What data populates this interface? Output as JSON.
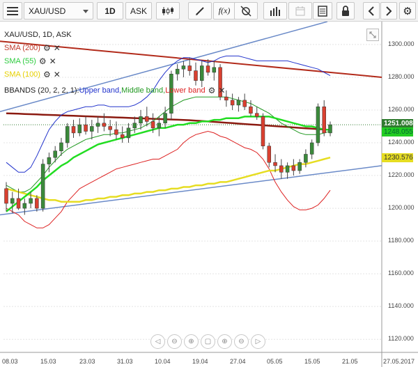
{
  "toolbar": {
    "symbol": "XAU/USD",
    "timeframe": "1D",
    "price_type": "ASK",
    "fx_label": "f(x)"
  },
  "chart_header": {
    "instrument": "XAU/USD, 1D, ASK"
  },
  "indicators": [
    {
      "label": "SMA (200)",
      "color": "#c0392b"
    },
    {
      "label": "SMA (55)",
      "color": "#2ecc40"
    },
    {
      "label": "SMA (100)",
      "color": "#e6d000"
    }
  ],
  "bbands": {
    "prefix": "BBANDS (20, 2, 2, 1): ",
    "upper": "Upper band,",
    "middle": " Middle band,",
    "lower": " Lower band",
    "upper_color": "#2233cc",
    "middle_color": "#229922",
    "lower_color": "#dd2222"
  },
  "price_axis": {
    "ticks": [
      "1300.000",
      "1280.000",
      "1260.000",
      "1240.000",
      "1220.000",
      "1200.000",
      "1180.000",
      "1160.000",
      "1140.000",
      "1120.000"
    ],
    "current_price": "1251.008",
    "sma55_value": "1248.055",
    "sma100_value": "1230.576"
  },
  "time_axis": {
    "ticks": [
      "08.03",
      "15.03",
      "23.03",
      "31.03",
      "10.04",
      "19.04",
      "27.04",
      "05.05",
      "15.05",
      "21.05"
    ],
    "current_date": "27.05.2017"
  },
  "colors": {
    "bull": "#3b8a3b",
    "bear": "#d94030",
    "sma200": "#b22a1a",
    "sma200_long": "#8b1a10",
    "sma55": "#22dd22",
    "sma100": "#e6dd22",
    "trend": "#6a8ac8"
  },
  "chart_data": {
    "type": "candlestick",
    "ylim": [
      1112,
      1314
    ],
    "candles": [
      {
        "o": 1212,
        "h": 1216,
        "l": 1198,
        "c": 1203
      },
      {
        "o": 1203,
        "h": 1210,
        "l": 1197,
        "c": 1206
      },
      {
        "o": 1206,
        "h": 1212,
        "l": 1199,
        "c": 1200
      },
      {
        "o": 1200,
        "h": 1206,
        "l": 1196,
        "c": 1203
      },
      {
        "o": 1203,
        "h": 1210,
        "l": 1200,
        "c": 1206
      },
      {
        "o": 1206,
        "h": 1208,
        "l": 1198,
        "c": 1200
      },
      {
        "o": 1200,
        "h": 1230,
        "l": 1198,
        "c": 1227
      },
      {
        "o": 1227,
        "h": 1234,
        "l": 1222,
        "c": 1231
      },
      {
        "o": 1231,
        "h": 1238,
        "l": 1228,
        "c": 1235
      },
      {
        "o": 1235,
        "h": 1243,
        "l": 1232,
        "c": 1240
      },
      {
        "o": 1240,
        "h": 1252,
        "l": 1237,
        "c": 1250
      },
      {
        "o": 1250,
        "h": 1254,
        "l": 1243,
        "c": 1246
      },
      {
        "o": 1246,
        "h": 1255,
        "l": 1244,
        "c": 1251
      },
      {
        "o": 1251,
        "h": 1256,
        "l": 1245,
        "c": 1247
      },
      {
        "o": 1247,
        "h": 1254,
        "l": 1242,
        "c": 1250
      },
      {
        "o": 1250,
        "h": 1256,
        "l": 1246,
        "c": 1252
      },
      {
        "o": 1252,
        "h": 1258,
        "l": 1247,
        "c": 1250
      },
      {
        "o": 1250,
        "h": 1254,
        "l": 1244,
        "c": 1248
      },
      {
        "o": 1248,
        "h": 1253,
        "l": 1242,
        "c": 1245
      },
      {
        "o": 1245,
        "h": 1250,
        "l": 1240,
        "c": 1243
      },
      {
        "o": 1243,
        "h": 1252,
        "l": 1240,
        "c": 1249
      },
      {
        "o": 1249,
        "h": 1256,
        "l": 1246,
        "c": 1252
      },
      {
        "o": 1252,
        "h": 1260,
        "l": 1248,
        "c": 1256
      },
      {
        "o": 1256,
        "h": 1262,
        "l": 1250,
        "c": 1253
      },
      {
        "o": 1253,
        "h": 1258,
        "l": 1246,
        "c": 1249
      },
      {
        "o": 1249,
        "h": 1256,
        "l": 1244,
        "c": 1252
      },
      {
        "o": 1252,
        "h": 1262,
        "l": 1249,
        "c": 1258
      },
      {
        "o": 1258,
        "h": 1284,
        "l": 1254,
        "c": 1282
      },
      {
        "o": 1282,
        "h": 1288,
        "l": 1278,
        "c": 1285
      },
      {
        "o": 1285,
        "h": 1290,
        "l": 1280,
        "c": 1287
      },
      {
        "o": 1287,
        "h": 1292,
        "l": 1281,
        "c": 1284
      },
      {
        "o": 1284,
        "h": 1289,
        "l": 1275,
        "c": 1278
      },
      {
        "o": 1278,
        "h": 1290,
        "l": 1274,
        "c": 1287
      },
      {
        "o": 1287,
        "h": 1291,
        "l": 1281,
        "c": 1283
      },
      {
        "o": 1283,
        "h": 1290,
        "l": 1278,
        "c": 1286
      },
      {
        "o": 1286,
        "h": 1288,
        "l": 1266,
        "c": 1268
      },
      {
        "o": 1268,
        "h": 1272,
        "l": 1262,
        "c": 1266
      },
      {
        "o": 1266,
        "h": 1270,
        "l": 1260,
        "c": 1263
      },
      {
        "o": 1263,
        "h": 1268,
        "l": 1259,
        "c": 1266
      },
      {
        "o": 1266,
        "h": 1270,
        "l": 1260,
        "c": 1262
      },
      {
        "o": 1262,
        "h": 1266,
        "l": 1256,
        "c": 1258
      },
      {
        "o": 1258,
        "h": 1262,
        "l": 1254,
        "c": 1256
      },
      {
        "o": 1256,
        "h": 1258,
        "l": 1236,
        "c": 1238
      },
      {
        "o": 1238,
        "h": 1240,
        "l": 1225,
        "c": 1228
      },
      {
        "o": 1228,
        "h": 1233,
        "l": 1222,
        "c": 1226
      },
      {
        "o": 1226,
        "h": 1230,
        "l": 1218,
        "c": 1222
      },
      {
        "o": 1222,
        "h": 1228,
        "l": 1218,
        "c": 1226
      },
      {
        "o": 1226,
        "h": 1230,
        "l": 1220,
        "c": 1223
      },
      {
        "o": 1223,
        "h": 1230,
        "l": 1221,
        "c": 1228
      },
      {
        "o": 1228,
        "h": 1236,
        "l": 1225,
        "c": 1233
      },
      {
        "o": 1233,
        "h": 1242,
        "l": 1230,
        "c": 1240
      },
      {
        "o": 1240,
        "h": 1264,
        "l": 1238,
        "c": 1262
      },
      {
        "o": 1262,
        "h": 1266,
        "l": 1244,
        "c": 1246
      },
      {
        "o": 1246,
        "h": 1253,
        "l": 1244,
        "c": 1251
      }
    ],
    "sma200": {
      "from": [
        1249,
        1251,
        1248
      ],
      "note": ""
    },
    "sma55": [
      1198,
      1201,
      1204,
      1207,
      1210,
      1213,
      1217,
      1220,
      1223,
      1226,
      1228,
      1231,
      1233,
      1235,
      1237,
      1239,
      1240,
      1241,
      1242,
      1243,
      1244,
      1245,
      1246,
      1247,
      1248,
      1249,
      1249,
      1250,
      1251,
      1251,
      1252,
      1252,
      1253,
      1253,
      1254,
      1254,
      1255,
      1255,
      1255,
      1256,
      1256,
      1256,
      1256,
      1256,
      1255,
      1254,
      1253,
      1252,
      1251,
      1250,
      1250,
      1249,
      1248,
      1248
    ],
    "sma100": [
      1212,
      1211,
      1210,
      1209,
      1208,
      1207,
      1206,
      1205,
      1205,
      1204,
      1204,
      1204,
      1204,
      1205,
      1205,
      1206,
      1206,
      1207,
      1207,
      1208,
      1208,
      1209,
      1209,
      1210,
      1210,
      1211,
      1211,
      1212,
      1212,
      1213,
      1213,
      1214,
      1214,
      1215,
      1215,
      1216,
      1216,
      1217,
      1218,
      1219,
      1220,
      1221,
      1222,
      1223,
      1223,
      1224,
      1225,
      1226,
      1227,
      1227,
      1228,
      1229,
      1230,
      1231
    ],
    "bb_upper": [
      1228,
      1225,
      1222,
      1222,
      1225,
      1232,
      1240,
      1248,
      1253,
      1257,
      1259,
      1260,
      1261,
      1262,
      1262,
      1263,
      1263,
      1262,
      1262,
      1262,
      1262,
      1263,
      1265,
      1268,
      1272,
      1278,
      1283,
      1287,
      1290,
      1292,
      1292,
      1291,
      1290,
      1289,
      1290,
      1292,
      1293,
      1293,
      1293,
      1292,
      1291,
      1290,
      1290,
      1290,
      1290,
      1290,
      1290,
      1289,
      1288,
      1287,
      1286,
      1285,
      1283,
      1281
    ],
    "bb_middle": [
      1214,
      1212,
      1210,
      1210,
      1212,
      1216,
      1220,
      1225,
      1229,
      1233,
      1236,
      1238,
      1240,
      1242,
      1243,
      1244,
      1245,
      1245,
      1246,
      1246,
      1247,
      1248,
      1249,
      1251,
      1253,
      1256,
      1259,
      1262,
      1264,
      1266,
      1267,
      1268,
      1268,
      1268,
      1268,
      1268,
      1268,
      1267,
      1266,
      1265,
      1264,
      1262,
      1260,
      1258,
      1255,
      1252,
      1250,
      1248,
      1246,
      1245,
      1245,
      1245,
      1246,
      1247
    ],
    "bb_lower": [
      1200,
      1198,
      1196,
      1192,
      1190,
      1188,
      1188,
      1190,
      1194,
      1198,
      1204,
      1208,
      1212,
      1214,
      1216,
      1218,
      1220,
      1222,
      1224,
      1225,
      1226,
      1227,
      1228,
      1229,
      1230,
      1230,
      1232,
      1234,
      1236,
      1240,
      1243,
      1245,
      1246,
      1247,
      1246,
      1244,
      1243,
      1241,
      1239,
      1237,
      1236,
      1234,
      1230,
      1224,
      1216,
      1210,
      1205,
      1201,
      1199,
      1199,
      1200,
      1202,
      1206,
      1211
    ]
  }
}
